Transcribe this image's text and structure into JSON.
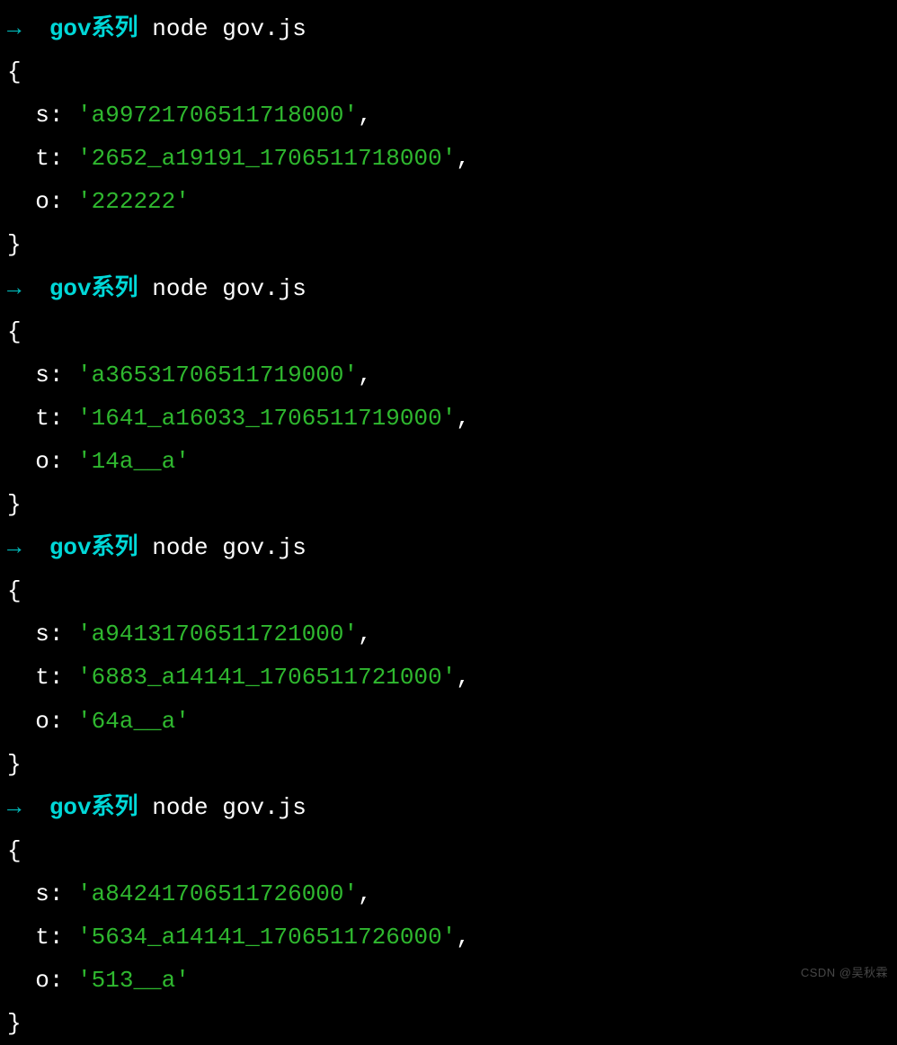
{
  "prompt": {
    "arrow": "→",
    "dir": "gov系列",
    "command": "node gov.js"
  },
  "braces": {
    "open": "{",
    "close": "}"
  },
  "keys": {
    "s": "s",
    "t": "t",
    "o": "o"
  },
  "punct": {
    "colon_space": ": ",
    "comma": ","
  },
  "runs": [
    {
      "s": "'a99721706511718000'",
      "t": "'2652_a19191_1706511718000'",
      "o": "'222222'"
    },
    {
      "s": "'a36531706511719000'",
      "t": "'1641_a16033_1706511719000'",
      "o": "'14a__a'"
    },
    {
      "s": "'a94131706511721000'",
      "t": "'6883_a14141_1706511721000'",
      "o": "'64a__a'"
    },
    {
      "s": "'a84241706511726000'",
      "t": "'5634_a14141_1706511726000'",
      "o": "'513__a'"
    }
  ],
  "watermark": "CSDN @吴秋霖"
}
